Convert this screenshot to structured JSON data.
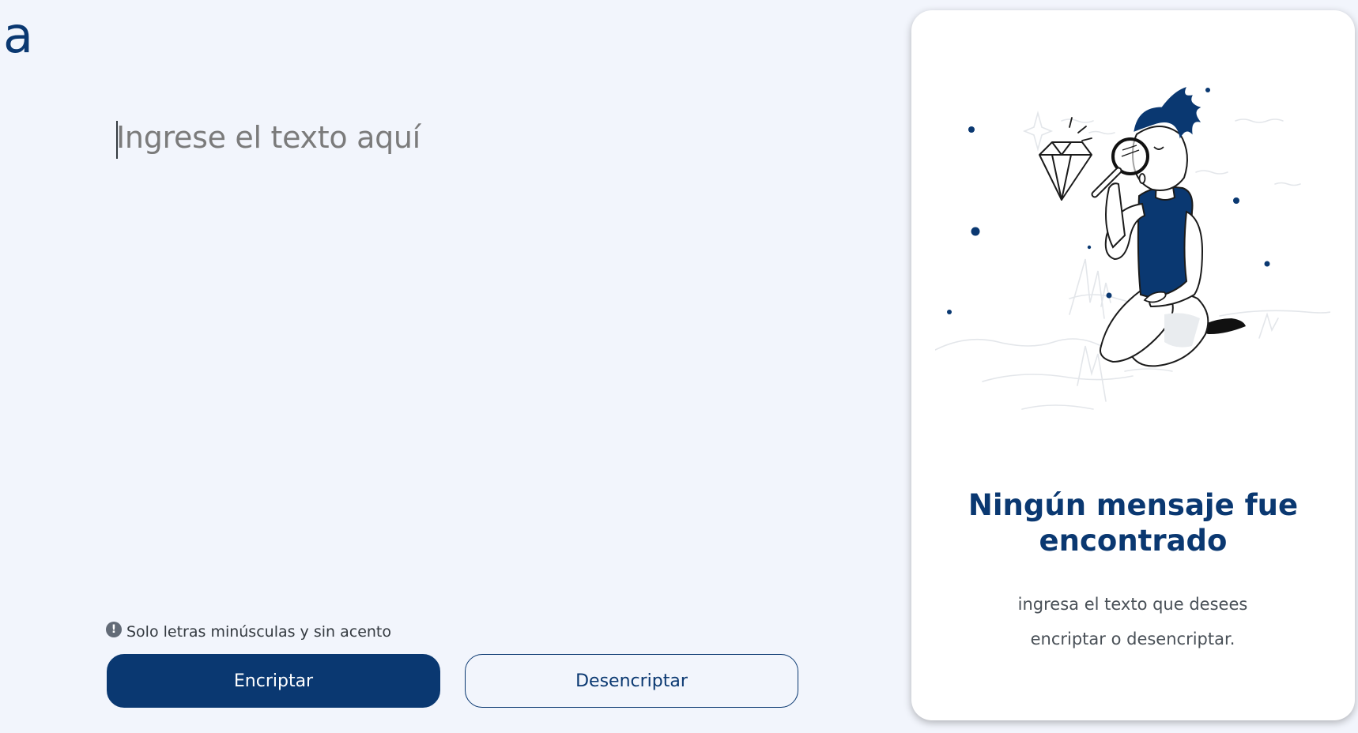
{
  "logo": {
    "text": "a"
  },
  "input": {
    "placeholder": "Ingrese el texto aquí",
    "value": ""
  },
  "hint": {
    "icon": "exclamation-circle-icon",
    "text": "Solo letras minúsculas y sin acento"
  },
  "buttons": {
    "encrypt_label": "Encriptar",
    "decrypt_label": "Desencriptar"
  },
  "output_panel": {
    "title_line1": "Ningún mensaje fue",
    "title_line2": "encontrado",
    "subtitle_line1": "ingresa el texto que desees",
    "subtitle_line2": "encriptar o desencriptar.",
    "illustration": "person-with-magnifying-glass-and-diamond"
  },
  "colors": {
    "background": "#f2f5fc",
    "primary": "#0a3871",
    "placeholder": "#7b7b7b",
    "panel": "#ffffff"
  }
}
